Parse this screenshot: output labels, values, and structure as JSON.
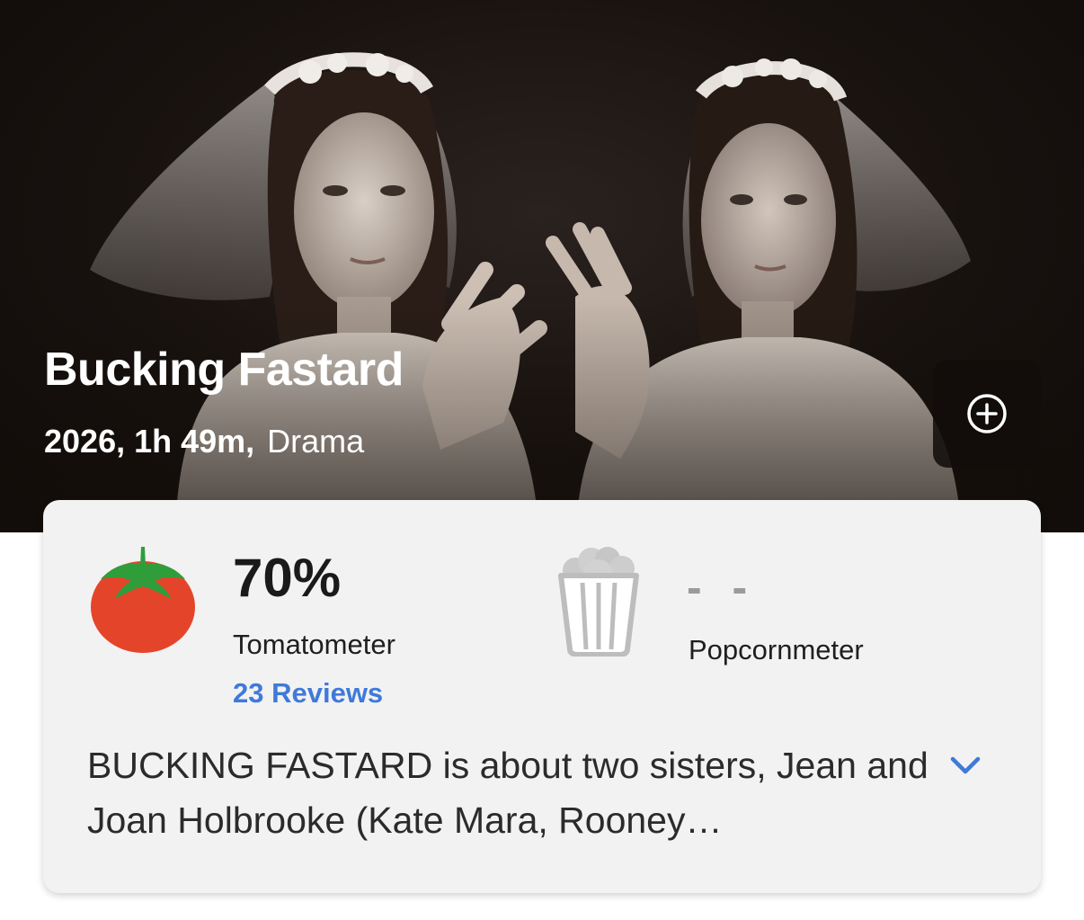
{
  "movie": {
    "title": "Bucking Fastard",
    "year_runtime": "2026, 1h 49m,",
    "genre": "Drama",
    "hero_image": "two women in bridal veils"
  },
  "actions": {
    "add_watchlist_icon": "plus-circle-icon"
  },
  "scores": {
    "tomatometer": {
      "value": "70%",
      "label": "Tomatometer",
      "reviews": "23 Reviews",
      "icon": "tomato-icon"
    },
    "popcornmeter": {
      "value": "- -",
      "label": "Popcornmeter",
      "icon": "popcorn-bucket-icon"
    }
  },
  "synopsis": {
    "text": "BUCKING FASTARD is about two sisters, Jean and Joan Holbrooke (Kate Mara, Rooney…",
    "expand_icon": "chevron-down-icon"
  },
  "colors": {
    "accent_link": "#3f7ad9",
    "tomato_red": "#e4452a",
    "tomato_leaf": "#2f9e3a",
    "card_background": "#f2f2f3"
  }
}
